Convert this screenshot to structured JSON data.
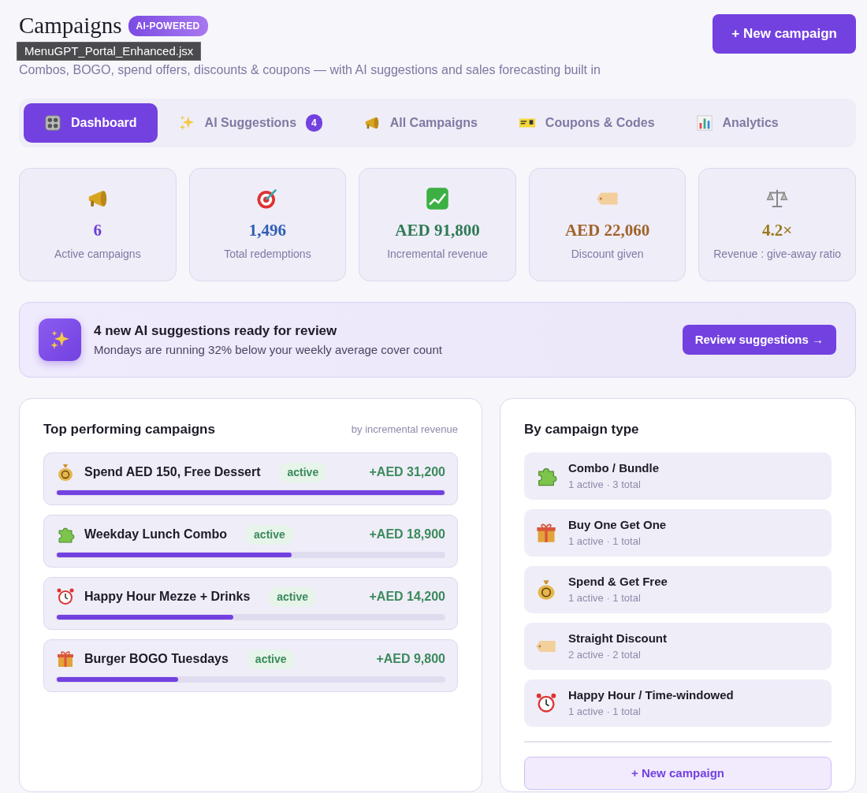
{
  "header": {
    "title": "Campaigns",
    "badge": "AI-POWERED",
    "tooltip": "MenuGPT_Portal_Enhanced.jsx",
    "subtitle": "Combos, BOGO, spend offers, discounts & coupons — with AI suggestions and sales forecasting built in",
    "new_button": "+ New campaign"
  },
  "tabs": [
    {
      "label": "Dashboard",
      "selected": true
    },
    {
      "label": "AI Suggestions",
      "count": "4",
      "selected": false
    },
    {
      "label": "All Campaigns",
      "selected": false
    },
    {
      "label": "Coupons & Codes",
      "selected": false
    },
    {
      "label": "Analytics",
      "selected": false
    }
  ],
  "stats": [
    {
      "value": "6",
      "label": "Active campaigns",
      "color": "#6d3fd6"
    },
    {
      "value": "1,496",
      "label": "Total redemptions",
      "color": "#2f5fb3"
    },
    {
      "value": "AED 91,800",
      "label": "Incremental revenue",
      "color": "#2f7a55"
    },
    {
      "value": "AED 22,060",
      "label": "Discount given",
      "color": "#a0622a"
    },
    {
      "value": "4.2×",
      "label": "Revenue : give-away ratio",
      "color": "#9a7a1e"
    }
  ],
  "banner": {
    "title": "4 new AI suggestions ready for review",
    "text": "Mondays are running 32% below your weekly average cover count",
    "button": "Review suggestions →"
  },
  "top_campaigns": {
    "title": "Top performing campaigns",
    "note": "by incremental revenue",
    "items": [
      {
        "kind": "spend",
        "name": "Spend AED 150, Free Dessert",
        "status": "active",
        "amount": "+AED 31,200",
        "level": 1.0
      },
      {
        "kind": "combo",
        "name": "Weekday Lunch Combo",
        "status": "active",
        "amount": "+AED 18,900",
        "level": 0.605
      },
      {
        "kind": "happy_hour",
        "name": "Happy Hour Mezze + Drinks",
        "status": "active",
        "amount": "+AED 14,200",
        "level": 0.455
      },
      {
        "kind": "bogo",
        "name": "Burger BOGO Tuesdays",
        "status": "active",
        "amount": "+AED 9,800",
        "level": 0.314
      }
    ]
  },
  "by_type": {
    "title": "By campaign type",
    "items": [
      {
        "kind": "combo",
        "name": "Combo / Bundle",
        "counts": "1 active · 3 total"
      },
      {
        "kind": "bogo",
        "name": "Buy One Get One",
        "counts": "1 active · 1 total"
      },
      {
        "kind": "spend",
        "name": "Spend & Get Free",
        "counts": "1 active · 1 total"
      },
      {
        "kind": "discount",
        "name": "Straight Discount",
        "counts": "2 active · 2 total"
      },
      {
        "kind": "happy_hour",
        "name": "Happy Hour / Time-windowed",
        "counts": "1 active · 1 total"
      }
    ],
    "button": "+ New campaign"
  }
}
